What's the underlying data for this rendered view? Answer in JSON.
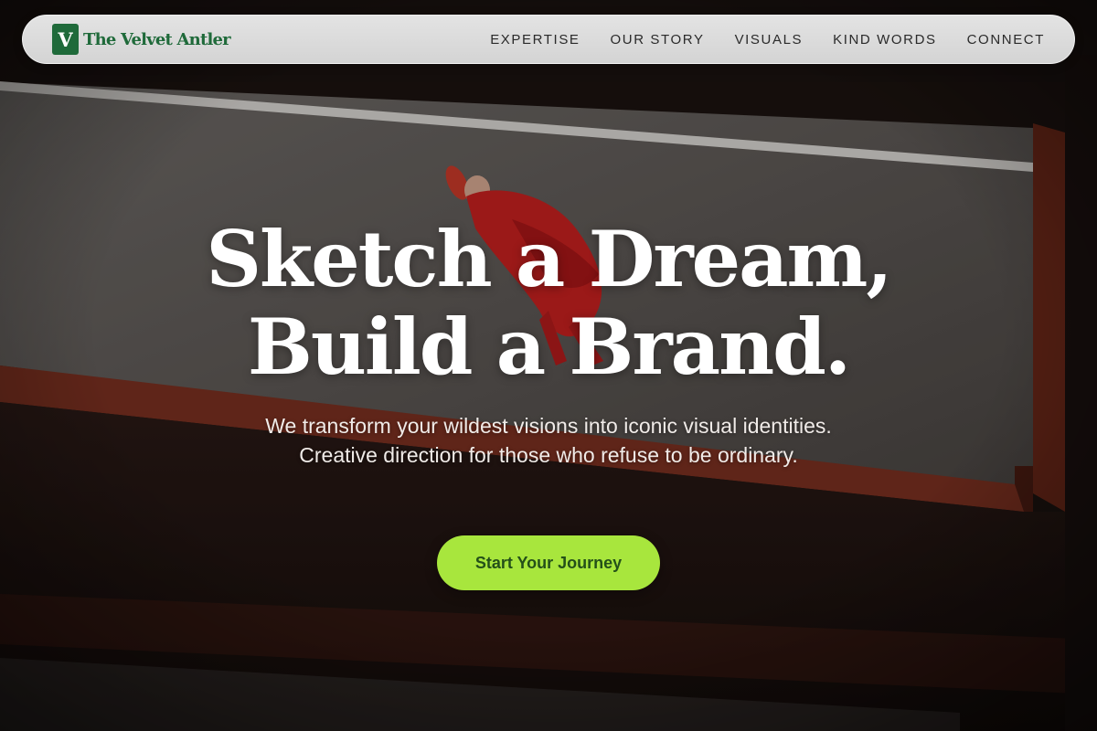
{
  "brand": {
    "logo_letter": "V",
    "name": "The Velvet Antler",
    "color": "#1f6a3a"
  },
  "nav": {
    "items": [
      {
        "label": "EXPERTISE"
      },
      {
        "label": "OUR STORY"
      },
      {
        "label": "VISUALS"
      },
      {
        "label": "KIND WORDS"
      },
      {
        "label": "CONNECT"
      }
    ]
  },
  "hero": {
    "headline_line1": "Sketch a Dream,",
    "headline_line2": "Build a Brand.",
    "subtitle": "We transform your wildest visions into iconic visual identities. Creative direction for those who refuse to be ordinary.",
    "cta_label": "Start Your Journey",
    "cta_color": "#a8e63d",
    "background_image": "overhead-photo-person-in-red-dress-on-grey-concrete-ramp"
  }
}
